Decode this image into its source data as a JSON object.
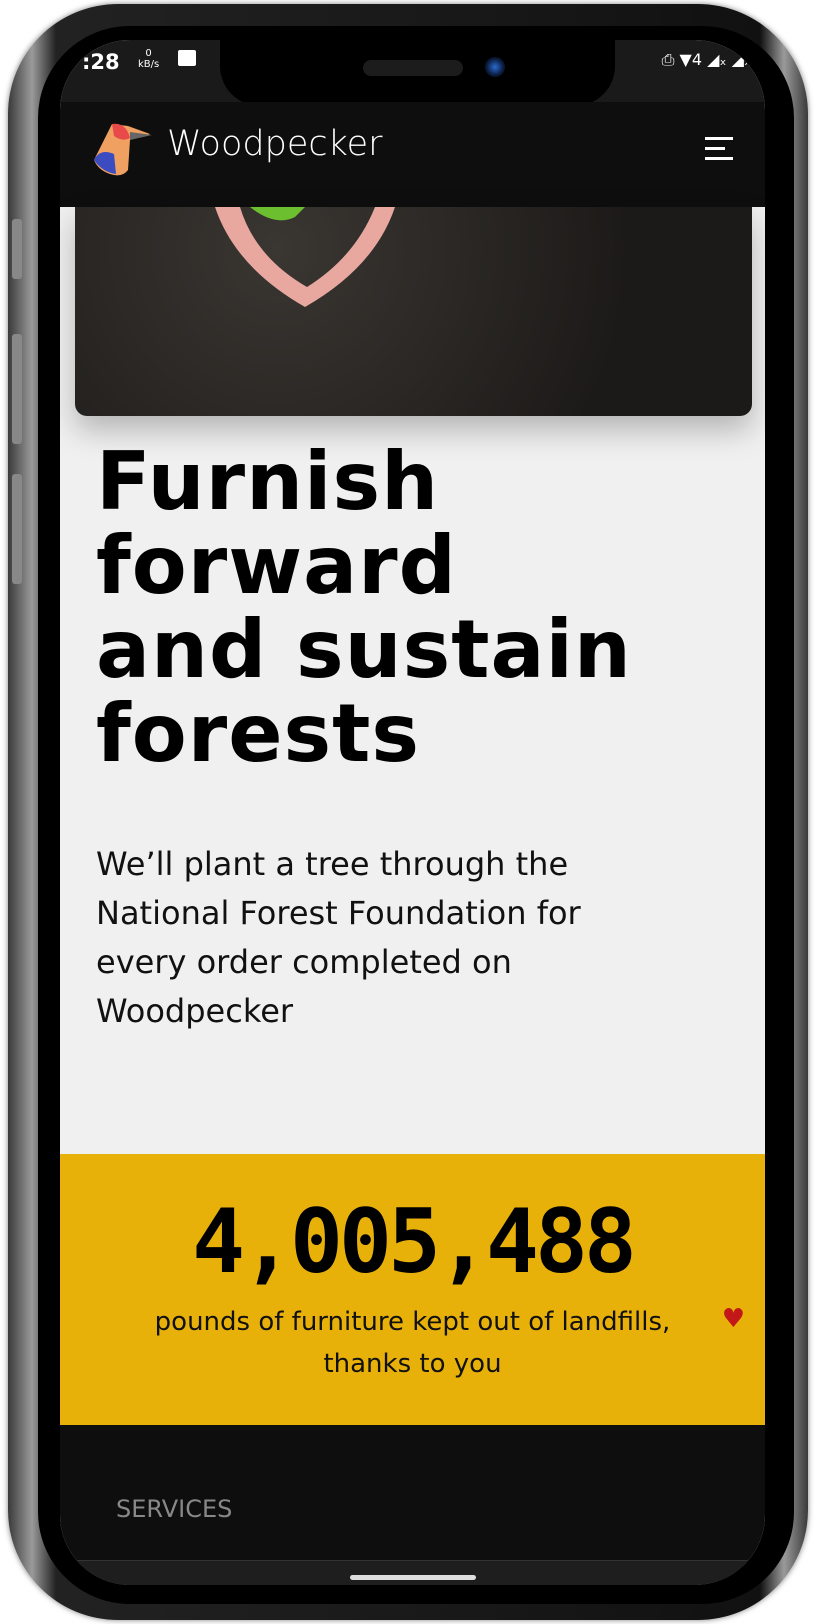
{
  "status_bar": {
    "time": ":28",
    "net_speed": "0",
    "net_unit": "kB/s",
    "right_icons": "⎙ ▼4 ◢ₓ ◢ₓ"
  },
  "header": {
    "brand": "Woodpecker"
  },
  "hero": {
    "heading_lines": [
      "Furnish",
      "forward",
      "and sustain",
      "forests"
    ],
    "description": "We’ll plant a tree through the National Forest Foundation for every order completed on Woodpecker"
  },
  "stats": {
    "value": "4,005,488",
    "caption": "pounds of furniture kept out of landfills, thanks to you",
    "heart": "♥"
  },
  "footer": {
    "section_label": "SERVICES"
  },
  "colors": {
    "accent": "#e8b10a",
    "header": "#0e0e0e",
    "heart": "#c21818"
  }
}
